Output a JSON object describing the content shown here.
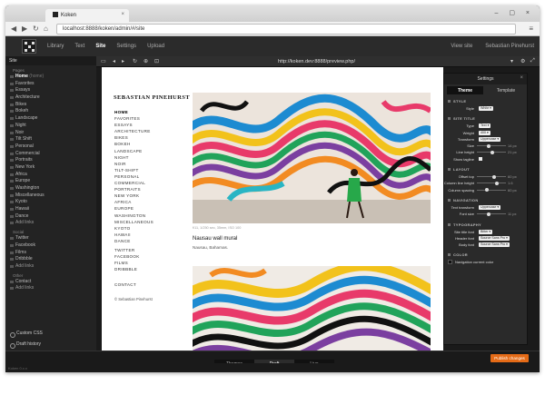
{
  "browser": {
    "tab_title": "Koken",
    "url": "localhost:8888/koken/admin/#/site",
    "tab_close": "×",
    "window_buttons": "– ▢ ×",
    "back": "◀",
    "forward": "▶",
    "reload": "↻",
    "home": "⌂",
    "menu": "≡"
  },
  "app": {
    "nav": [
      "Library",
      "Text",
      "Site",
      "Settings",
      "Upload"
    ],
    "active_nav": "Site",
    "view_site": "View site",
    "user": "Sebastian Pinehurst"
  },
  "sidebar": {
    "header": "Site",
    "groups": [
      {
        "name": "Pages",
        "items": [
          {
            "label": "Home",
            "note": "(home)",
            "active": true
          },
          {
            "label": "Favorites"
          },
          {
            "label": "Essays"
          },
          {
            "label": "Architecture"
          },
          {
            "label": "Bikes"
          },
          {
            "label": "Bokeh"
          },
          {
            "label": "Landscape"
          },
          {
            "label": "Night"
          },
          {
            "label": "Noir"
          },
          {
            "label": "Tilt Shift"
          },
          {
            "label": "Personal"
          },
          {
            "label": "Commercial"
          },
          {
            "label": "Portraits"
          },
          {
            "label": "New York"
          },
          {
            "label": "Africa"
          },
          {
            "label": "Europe"
          },
          {
            "label": "Washington"
          },
          {
            "label": "Miscellaneous"
          },
          {
            "label": "Kyoto"
          },
          {
            "label": "Hawaii"
          },
          {
            "label": "Dance"
          },
          {
            "label": "Add links",
            "add": true
          }
        ]
      },
      {
        "name": "Social",
        "items": [
          {
            "label": "Twitter"
          },
          {
            "label": "Facebook"
          },
          {
            "label": "Films"
          },
          {
            "label": "Dribbble"
          },
          {
            "label": "Add links",
            "add": true
          }
        ]
      },
      {
        "name": "Other",
        "items": [
          {
            "label": "Contact"
          },
          {
            "label": "Add links",
            "add": true
          }
        ]
      }
    ],
    "custom_css": "Custom CSS",
    "draft_history": "Draft history"
  },
  "toolbar": {
    "preview_url": "http://koken.dev:8888/preview.php/",
    "buttons": [
      "▭",
      "◂",
      "▸",
      "↻",
      "⊕",
      "⊡"
    ],
    "right_buttons": [
      "▾",
      "⚙",
      "⤢"
    ]
  },
  "preview": {
    "site_title": "SEBASTIAN PINEHURST",
    "nav": [
      "HOME",
      "FAVORITES",
      "ESSAYS",
      "ARCHITECTURE",
      "BIKES",
      "BOKEH",
      "LANDSCAPE",
      "NIGHT",
      "NOIR",
      "TILT-SHIFT",
      "PERSONAL",
      "COMMERCIAL",
      "PORTRAITS",
      "NEW YORK",
      "AFRICA",
      "EUROPE",
      "WASHINGTON",
      "MISCELLANEOUS",
      "KYOTO",
      "HAWAII",
      "DANCE"
    ],
    "social": [
      "TWITTER",
      "FACEBOOK",
      "FILMS",
      "DRIBBBLE"
    ],
    "contact": "CONTACT",
    "copyright": "© Sebastian Pinehurst",
    "photo_meta": "f/11, 1/250 sec, 35mm, ISO 100",
    "photo_title": "Nausau wall mural",
    "photo_location": "Nausau, Bahamas."
  },
  "settings": {
    "title": "Settings",
    "tabs": [
      "Theme",
      "Template"
    ],
    "active_tab": "Theme",
    "sections": [
      {
        "name": "STYLE",
        "rows": [
          {
            "label": "Style",
            "type": "select",
            "value": "White"
          }
        ]
      },
      {
        "name": "SITE TITLE",
        "rows": [
          {
            "label": "Type",
            "type": "select",
            "value": "Text"
          },
          {
            "label": "Weight",
            "type": "select",
            "value": "400"
          },
          {
            "label": "Transform",
            "type": "select",
            "value": "Uppercase"
          },
          {
            "label": "Size",
            "type": "slider",
            "value": "14 px",
            "pos": 0.35
          },
          {
            "label": "Line height",
            "type": "slider",
            "value": "21 px",
            "pos": 0.5
          },
          {
            "label": "Show tagline",
            "type": "check"
          }
        ]
      },
      {
        "name": "LAYOUT",
        "rows": [
          {
            "label": "Offset top",
            "type": "slider",
            "value": "60 px",
            "pos": 0.55
          },
          {
            "label": "Column line height",
            "type": "slider",
            "value": "1.6",
            "pos": 0.65
          },
          {
            "label": "Column spacing",
            "type": "slider",
            "value": "60 px",
            "pos": 0.3
          }
        ]
      },
      {
        "name": "NAVIGATION",
        "rows": [
          {
            "label": "Text transform",
            "type": "select",
            "value": "Uppercase"
          },
          {
            "label": "Font size",
            "type": "slider",
            "value": "11 px",
            "pos": 0.35
          }
        ]
      },
      {
        "name": "TYPOGRAPHY",
        "rows": [
          {
            "label": "Site title font",
            "type": "select",
            "value": "Bitter"
          },
          {
            "label": "Header font",
            "type": "select",
            "value": "Source Sans Pro"
          },
          {
            "label": "Body font",
            "type": "select",
            "value": "Source Sans Pro"
          }
        ]
      },
      {
        "name": "COLOR",
        "rows": [
          {
            "label": "Navigation current color",
            "type": "swatch"
          }
        ]
      }
    ]
  },
  "bottombar": {
    "tabs": [
      "Themes",
      "Draft",
      "Live"
    ],
    "active": "Draft",
    "publish": "Publish changes"
  },
  "status": "Koken 0.x.x",
  "colors": {
    "accent": "#e56b17",
    "chrome": "#1a1a1a"
  }
}
